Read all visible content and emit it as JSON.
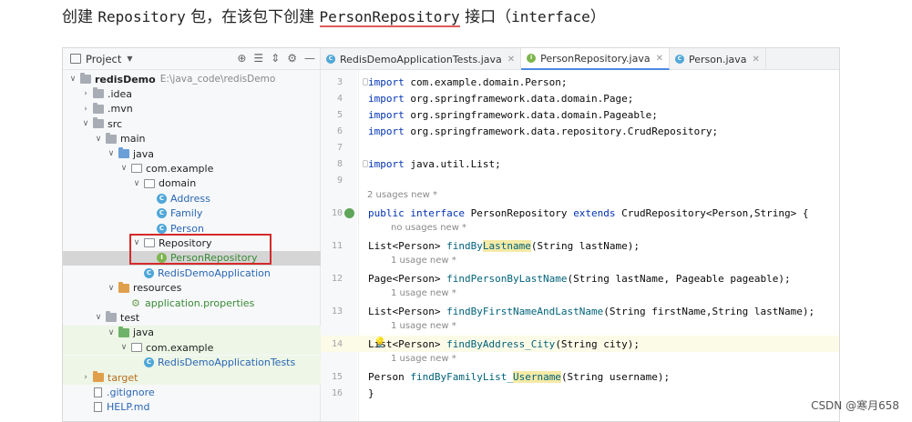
{
  "heading": {
    "part1": "创建 ",
    "part2": "Repository",
    "part3": " 包，在该包下创建 ",
    "part4": "PersonRepository",
    "part5": " 接口（",
    "part6": "interface",
    "part7": "）"
  },
  "project_panel": {
    "title": "Project",
    "tools": [
      "⊕",
      "☰",
      "⇕",
      "⚙",
      "—"
    ],
    "tree": [
      {
        "label": "redisDemo",
        "extra": "E:\\java_code\\redisDemo",
        "indent": 0,
        "arrow": "∨",
        "icon": "folder",
        "style": "bold"
      },
      {
        "label": ".idea",
        "indent": 1,
        "arrow": "›",
        "icon": "folder"
      },
      {
        "label": ".mvn",
        "indent": 1,
        "arrow": "›",
        "icon": "folder"
      },
      {
        "label": "src",
        "indent": 1,
        "arrow": "∨",
        "icon": "folder"
      },
      {
        "label": "main",
        "indent": 2,
        "arrow": "∨",
        "icon": "folder"
      },
      {
        "label": "java",
        "indent": 3,
        "arrow": "∨",
        "icon": "folder-blue"
      },
      {
        "label": "com.example",
        "indent": 4,
        "arrow": "∨",
        "icon": "pkg"
      },
      {
        "label": "domain",
        "indent": 5,
        "arrow": "∨",
        "icon": "pkg"
      },
      {
        "label": "Address",
        "indent": 6,
        "arrow": "",
        "icon": "class",
        "style": "blue"
      },
      {
        "label": "Family",
        "indent": 6,
        "arrow": "",
        "icon": "class",
        "style": "blue"
      },
      {
        "label": "Person",
        "indent": 6,
        "arrow": "",
        "icon": "class",
        "style": "blue"
      },
      {
        "label": "Repository",
        "indent": 5,
        "arrow": "∨",
        "icon": "pkg"
      },
      {
        "label": "PersonRepository",
        "indent": 6,
        "arrow": "",
        "icon": "interface",
        "style": "green",
        "selected": true
      },
      {
        "label": "RedisDemoApplication",
        "indent": 5,
        "arrow": "",
        "icon": "class",
        "style": "blue"
      },
      {
        "label": "resources",
        "indent": 3,
        "arrow": "∨",
        "icon": "folder-orange"
      },
      {
        "label": "application.properties",
        "indent": 4,
        "arrow": "",
        "icon": "gear",
        "style": "green"
      },
      {
        "label": "test",
        "indent": 2,
        "arrow": "∨",
        "icon": "folder"
      },
      {
        "label": "java",
        "indent": 3,
        "arrow": "∨",
        "icon": "folder-green",
        "band": true
      },
      {
        "label": "com.example",
        "indent": 4,
        "arrow": "∨",
        "icon": "pkg",
        "band": true
      },
      {
        "label": "RedisDemoApplicationTests",
        "indent": 5,
        "arrow": "",
        "icon": "class",
        "style": "blue",
        "band": true
      },
      {
        "label": "target",
        "indent": 1,
        "arrow": "›",
        "icon": "folder-orange",
        "style": "orange",
        "band": true
      },
      {
        "label": ".gitignore",
        "indent": 1,
        "arrow": "",
        "icon": "doc",
        "style": "blue"
      },
      {
        "label": "HELP.md",
        "indent": 1,
        "arrow": "",
        "icon": "doc",
        "style": "blue"
      }
    ]
  },
  "tabs": [
    {
      "label": "RedisDemoApplicationTests.java",
      "icon": "C",
      "active": false
    },
    {
      "label": "PersonRepository.java",
      "icon": "I",
      "active": true
    },
    {
      "label": "Person.java",
      "icon": "C",
      "active": false
    }
  ],
  "editor": {
    "lines": [
      {
        "n": "3",
        "tokens": [
          [
            "kw",
            "import"
          ],
          [
            "",
            "com.example.domain.Person;"
          ]
        ]
      },
      {
        "n": "4",
        "tokens": [
          [
            "kw",
            "import"
          ],
          [
            "",
            "org.springframework.data.domain.Page;"
          ]
        ]
      },
      {
        "n": "5",
        "tokens": [
          [
            "kw",
            "import"
          ],
          [
            "",
            "org.springframework.data.domain.Pageable;"
          ]
        ]
      },
      {
        "n": "6",
        "tokens": [
          [
            "kw",
            "import"
          ],
          [
            "",
            "org.springframework.data.repository.CrudRepository;"
          ]
        ]
      },
      {
        "n": "7",
        "tokens": []
      },
      {
        "n": "8",
        "tokens": [
          [
            "kw",
            "import"
          ],
          [
            "",
            "java.util.List;"
          ]
        ]
      },
      {
        "n": "9",
        "tokens": []
      },
      {
        "hint": "2 usages   new *"
      },
      {
        "n": "10",
        "tokens": [
          [
            "kw",
            "public interface"
          ],
          [
            "",
            "PersonRepository"
          ],
          [
            "kw",
            "extends"
          ],
          [
            "",
            "CrudRepository<Person,String> {"
          ]
        ]
      },
      {
        "hint": "no usages   new *",
        "indent": true
      },
      {
        "n": "11",
        "tokens": [
          [
            "",
            "    List<Person> "
          ],
          [
            "fn",
            "findBy"
          ],
          [
            "fnhl",
            "Lastname"
          ],
          [
            "",
            "(String lastName);"
          ]
        ]
      },
      {
        "hint": "1 usage   new *",
        "indent": true
      },
      {
        "n": "12",
        "tokens": [
          [
            "",
            "    Page<Person> "
          ],
          [
            "fn",
            "findPersonByLastName"
          ],
          [
            "",
            "(String lastName, Pageable pageable);"
          ]
        ]
      },
      {
        "hint": "1 usage   new *",
        "indent": true
      },
      {
        "n": "13",
        "tokens": [
          [
            "",
            "    List<Person> "
          ],
          [
            "fn",
            "findByFirstNameAndLastName"
          ],
          [
            "",
            "(String firstName,String lastName);"
          ]
        ]
      },
      {
        "hint": "1 usage   new *",
        "indent": true
      },
      {
        "n": "14",
        "tokens": [
          [
            "",
            "    List<Person> "
          ],
          [
            "fn",
            "findByAddress_City"
          ],
          [
            "",
            "(String city);"
          ]
        ]
      },
      {
        "hint": "1 usage   new *",
        "indent": true
      },
      {
        "n": "15",
        "tokens": [
          [
            "",
            "    Person "
          ],
          [
            "fn",
            "findByFamilyList_"
          ],
          [
            "fnhl",
            "Username"
          ],
          [
            "",
            "(String username);"
          ]
        ]
      },
      {
        "n": "16",
        "tokens": [
          [
            "",
            "}"
          ]
        ]
      }
    ]
  },
  "watermark": "CSDN @寒月658"
}
